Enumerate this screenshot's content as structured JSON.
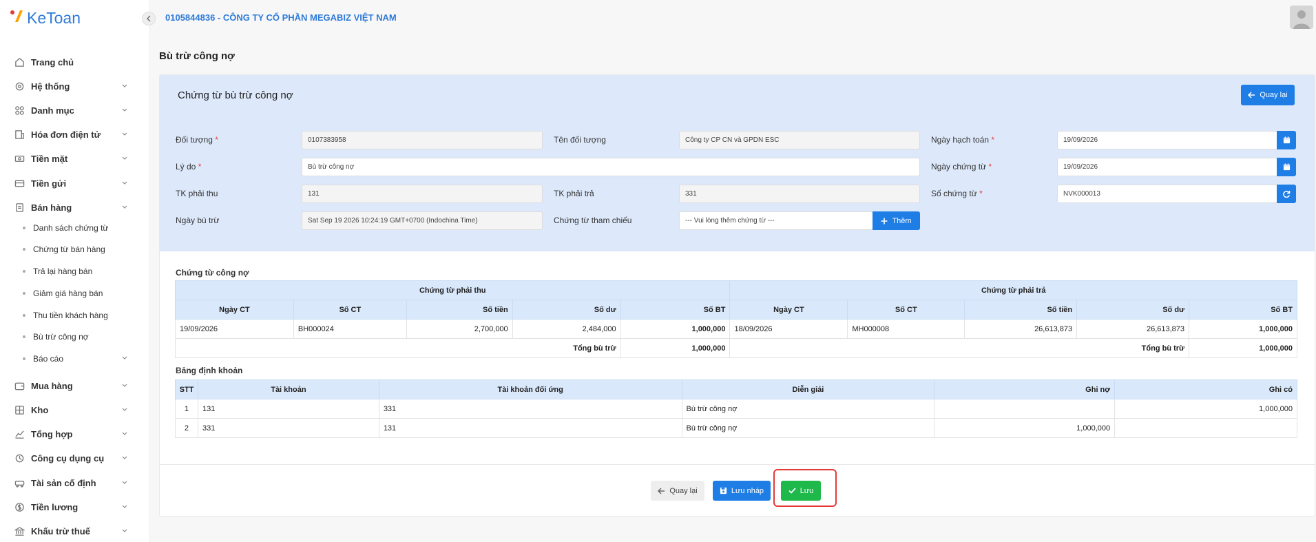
{
  "brand": {
    "logo_text": "KeToan"
  },
  "company_title": "0105844836 - CÔNG TY CỔ PHẦN MEGABIZ VIỆT NAM",
  "page_title": "Bù trừ công nợ",
  "sidebar": {
    "items": [
      {
        "label": "Trang chủ",
        "icon": "home-icon"
      },
      {
        "label": "Hệ thống",
        "icon": "gear-icon"
      },
      {
        "label": "Danh mục",
        "icon": "grid-icon"
      },
      {
        "label": "Hóa đơn điện tử",
        "icon": "invoice-icon"
      },
      {
        "label": "Tiền mặt",
        "icon": "cash-icon"
      },
      {
        "label": "Tiền gửi",
        "icon": "card-icon"
      },
      {
        "label": "Bán hàng",
        "icon": "sales-icon"
      }
    ],
    "sub_items": [
      {
        "label": "Danh sách chứng từ"
      },
      {
        "label": "Chứng từ bán hàng"
      },
      {
        "label": "Trả lại hàng bán"
      },
      {
        "label": "Giảm giá hàng bán"
      },
      {
        "label": "Thu tiền khách hàng"
      },
      {
        "label": "Bù trừ công nợ"
      },
      {
        "label": "Báo cáo"
      }
    ],
    "items_after": [
      {
        "label": "Mua hàng",
        "icon": "wallet-icon"
      },
      {
        "label": "Kho",
        "icon": "warehouse-icon"
      },
      {
        "label": "Tổng hợp",
        "icon": "chart-line-icon"
      },
      {
        "label": "Công cụ dụng cụ",
        "icon": "tool-icon"
      },
      {
        "label": "Tài sản cố định",
        "icon": "car-icon"
      },
      {
        "label": "Tiền lương",
        "icon": "dollar-icon"
      },
      {
        "label": "Khấu trừ thuế",
        "icon": "bank-icon"
      }
    ]
  },
  "form": {
    "card_title": "Chứng từ bù trừ công nợ",
    "back_label": "Quay lại",
    "doi_tuong_label": "Đối tượng",
    "doi_tuong_value": "0107383958",
    "ten_doi_tuong_label": "Tên đối tượng",
    "ten_doi_tuong_value": "Công ty CP CN và GPDN ESC",
    "ngay_hach_toan_label": "Ngày hạch toán",
    "ngay_hach_toan_value": "19/09/2026",
    "ly_do_label": "Lý do",
    "ly_do_value": "Bù trừ công nợ",
    "ngay_chung_tu_label": "Ngày chứng từ",
    "ngay_chung_tu_value": "19/09/2026",
    "tk_phai_thu_label": "TK phải thu",
    "tk_phai_thu_value": "131",
    "tk_phai_tra_label": "TK phải trả",
    "tk_phai_tra_value": "331",
    "so_chung_tu_label": "Số chứng từ",
    "so_chung_tu_value": "NVK000013",
    "ngay_bu_tru_label": "Ngày bù trừ",
    "ngay_bu_tru_value": "Sat Sep 19 2026 10:24:19 GMT+0700 (Indochina Time)",
    "chung_tu_tham_chieu_label": "Chứng từ tham chiếu",
    "chung_tu_tham_chieu_placeholder": "--- Vui lòng thêm chứng từ ---",
    "them_label": "Thêm",
    "required_mark": "*"
  },
  "debt_table": {
    "section_title": "Chứng từ công nợ",
    "group_left": "Chứng từ phải thu",
    "group_right": "Chứng từ phải trả",
    "headers": [
      "Ngày CT",
      "Số CT",
      "Số tiền",
      "Số dư",
      "Số BT",
      "Ngày CT",
      "Số CT",
      "Số tiền",
      "Số dư",
      "Số BT"
    ],
    "row": [
      "19/09/2026",
      "BH000024",
      "2,700,000",
      "2,484,000",
      "1,000,000",
      "18/09/2026",
      "MH000008",
      "26,613,873",
      "26,613,873",
      "1,000,000"
    ],
    "total_label_left": "Tổng bù trừ",
    "total_value_left": "1,000,000",
    "total_label_right": "Tổng bù trừ",
    "total_value_right": "1,000,000"
  },
  "entry_table": {
    "section_title": "Bảng định khoản",
    "headers": [
      "STT",
      "Tài khoản",
      "Tài khoản đối ứng",
      "Diễn giải",
      "Ghi nợ",
      "Ghi có"
    ],
    "rows": [
      [
        "1",
        "131",
        "331",
        "Bù trừ công nợ",
        "",
        "1,000,000"
      ],
      [
        "2",
        "331",
        "131",
        "Bù trừ công nợ",
        "1,000,000",
        ""
      ]
    ]
  },
  "footer": {
    "back_label": "Quay lại",
    "draft_label": "Lưu nháp",
    "save_label": "Lưu"
  },
  "colors": {
    "accent": "#1f7ee6",
    "success": "#1fb84a",
    "highlight": "#e53935"
  }
}
